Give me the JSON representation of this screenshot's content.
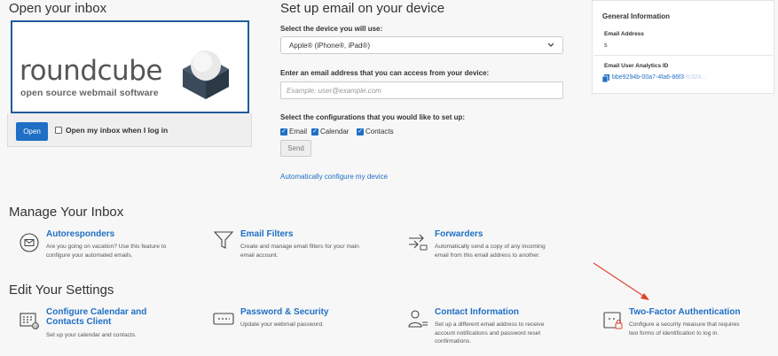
{
  "open_inbox": {
    "heading": "Open your inbox",
    "logo_word": "roundcube",
    "logo_tagline": "open source webmail software",
    "open_button": "Open",
    "open_on_login_label": "Open my inbox when I log in"
  },
  "setup": {
    "heading": "Set up email on your device",
    "device_label": "Select the device you will use:",
    "device_value": "Apple® (iPhone®, iPad®)",
    "email_label": "Enter an email address that you can access from your device:",
    "email_placeholder": "Example: user@example.com",
    "config_label": "Select the configurations that you would like to set up:",
    "options": [
      "Email",
      "Calendar",
      "Contacts"
    ],
    "send_button": "Send",
    "auto_link": "Automatically configure my device"
  },
  "general_info": {
    "title": "General Information",
    "email_address_label": "Email Address",
    "email_address_value": "s",
    "analytics_label": "Email User Analytics ID",
    "analytics_value": "bbe9294b-00a7-4fa6-86f3",
    "analytics_value_faded": "-fc324..."
  },
  "manage": {
    "heading": "Manage Your Inbox",
    "items": [
      {
        "title": "Autoresponders",
        "desc": "Are you going on vacation? Use this feature to\nconfigure your automated emails.",
        "icon": "autoresponder-icon"
      },
      {
        "title": "Email Filters",
        "desc": "Create and manage email filters for your main\nemail account.",
        "icon": "filter-icon"
      },
      {
        "title": "Forwarders",
        "desc": "Automatically send a copy of any incoming\nemail from this email address to another.",
        "icon": "forwarder-icon"
      }
    ]
  },
  "settings": {
    "heading": "Edit Your Settings",
    "items": [
      {
        "title": "Configure Calendar and\nContacts Client",
        "desc": "Set up your calendar and contacts.",
        "icon": "calendar-icon"
      },
      {
        "title": "Password & Security",
        "desc": "Update your webmail password.",
        "icon": "password-icon"
      },
      {
        "title": "Contact Information",
        "desc": "Set up a different email address to receive\naccount notifications and password reset\nconfirmations.",
        "icon": "contact-icon"
      },
      {
        "title": "Two-Factor Authentication",
        "desc": "Configure a security measure that requires\ntwo forms of identification to log in.",
        "icon": "two-factor-icon"
      }
    ]
  },
  "colors": {
    "accent": "#1f6fc5",
    "annotation_arrow": "#e0402e"
  }
}
